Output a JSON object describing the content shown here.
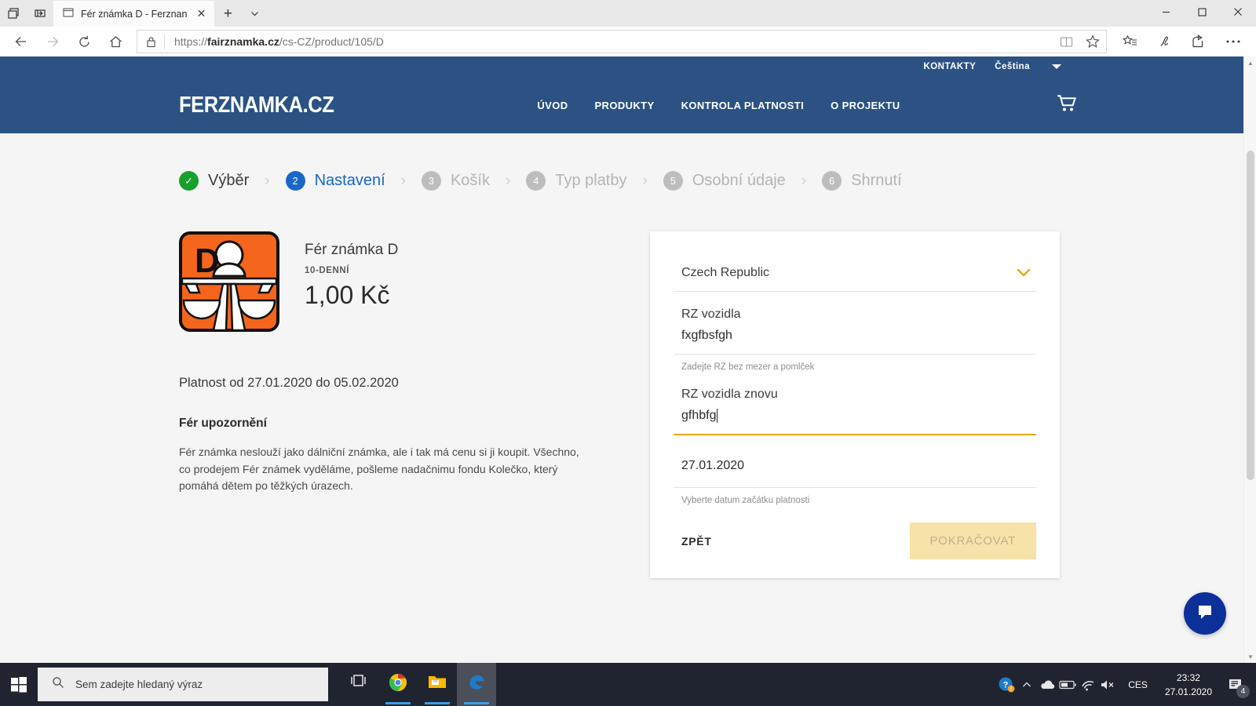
{
  "browser": {
    "tab_title": "Fér známka D - Ferznan",
    "new_tab_label": "+",
    "tab_close_label": "✕",
    "url_protocol": "https://",
    "url_domain": "fairznamka.cz",
    "url_path": "/cs-CZ/product/105/D",
    "icons": {
      "task_view": "task-view-icon",
      "collections": "collections-icon",
      "back": "back-arrow-icon",
      "forward": "forward-arrow-icon",
      "refresh": "refresh-icon",
      "home": "home-icon",
      "lock": "lock-icon",
      "reading_view": "reading-view-icon",
      "favorite": "star-icon",
      "favorites_list": "favorites-list-icon",
      "web_notes": "web-notes-pen-icon",
      "share": "share-icon",
      "more": "more-ellipsis-icon",
      "minimize": "minimize-icon",
      "maximize": "maximize-icon",
      "close": "window-close-icon"
    }
  },
  "site": {
    "topbar": {
      "contacts_label": "KONTAKTY",
      "language_label": "Čeština",
      "language_caret": "language-caret-icon"
    },
    "logo": "FERZNAMKA.CZ",
    "nav": [
      {
        "label": "ÚVOD"
      },
      {
        "label": "PRODUKTY"
      },
      {
        "label": "KONTROLA PLATNOSTI"
      },
      {
        "label": "O PROJEKTU"
      }
    ],
    "cart_icon": "shopping-cart-icon",
    "brand_color": "#2b5283",
    "accent_color": "#e8a917"
  },
  "steps": [
    {
      "num": "✓",
      "label": "Výběr",
      "state": "done"
    },
    {
      "num": "2",
      "label": "Nastavení",
      "state": "active"
    },
    {
      "num": "3",
      "label": "Košík",
      "state": "idle"
    },
    {
      "num": "4",
      "label": "Typ platby",
      "state": "idle"
    },
    {
      "num": "5",
      "label": "Osobní údaje",
      "state": "idle"
    },
    {
      "num": "6",
      "label": "Shrnutí",
      "state": "idle"
    }
  ],
  "step_separator": "›",
  "product": {
    "vignette_icon": "highway-vignette-d-icon",
    "vignette_letter": "D",
    "vignette_color": "#f5651c",
    "name": "Fér známka D",
    "duration": "10-DENNÍ",
    "price": "1,00 Kč",
    "validity": "Platnost od 27.01.2020 do 05.02.2020",
    "notice_heading": "Fér upozornění",
    "notice_text": "Fér známka neslouží jako dálniční známka, ale i tak má cenu si ji koupit. Všechno, co prodejem Fér známek vyděláme, pošleme nadačnimu fondu Kolečko, který pomáhá dětem po těžkých úrazech."
  },
  "form": {
    "country": {
      "value": "Czech Republic",
      "caret_icon": "chevron-down-icon"
    },
    "plate": {
      "label": "RZ vozidla",
      "value": "fxgfbsfgh",
      "hint": "Zadejte RZ bez mezer a pomlček"
    },
    "plate_repeat": {
      "label": "RZ vozidla znovu",
      "value": "gfhbfg",
      "focused": true
    },
    "date": {
      "value": "27.01.2020",
      "hint": "Vyberte datum začátku platnosti"
    },
    "back_label": "ZPĚT",
    "continue_label": "POKRAČOVAT"
  },
  "chat_widget": {
    "icon": "chat-bubble-icon",
    "color": "#0d2f99"
  },
  "taskbar": {
    "start_icon": "windows-start-icon",
    "search_placeholder": "Sem zadejte hledaný výraz",
    "search_icon": "search-icon",
    "apps": [
      {
        "name": "task-view-icon"
      },
      {
        "name": "chrome-icon"
      },
      {
        "name": "file-explorer-icon"
      },
      {
        "name": "edge-icon"
      }
    ],
    "tray": [
      {
        "name": "help-question-icon"
      },
      {
        "name": "show-hidden-icons-chevron"
      },
      {
        "name": "onedrive-cloud-icon"
      },
      {
        "name": "battery-icon"
      },
      {
        "name": "wifi-icon"
      },
      {
        "name": "volume-muted-icon"
      }
    ],
    "language": "CES",
    "time": "23:32",
    "date": "27.01.2020",
    "action_center_icon": "action-center-icon",
    "notification_count": "4"
  }
}
